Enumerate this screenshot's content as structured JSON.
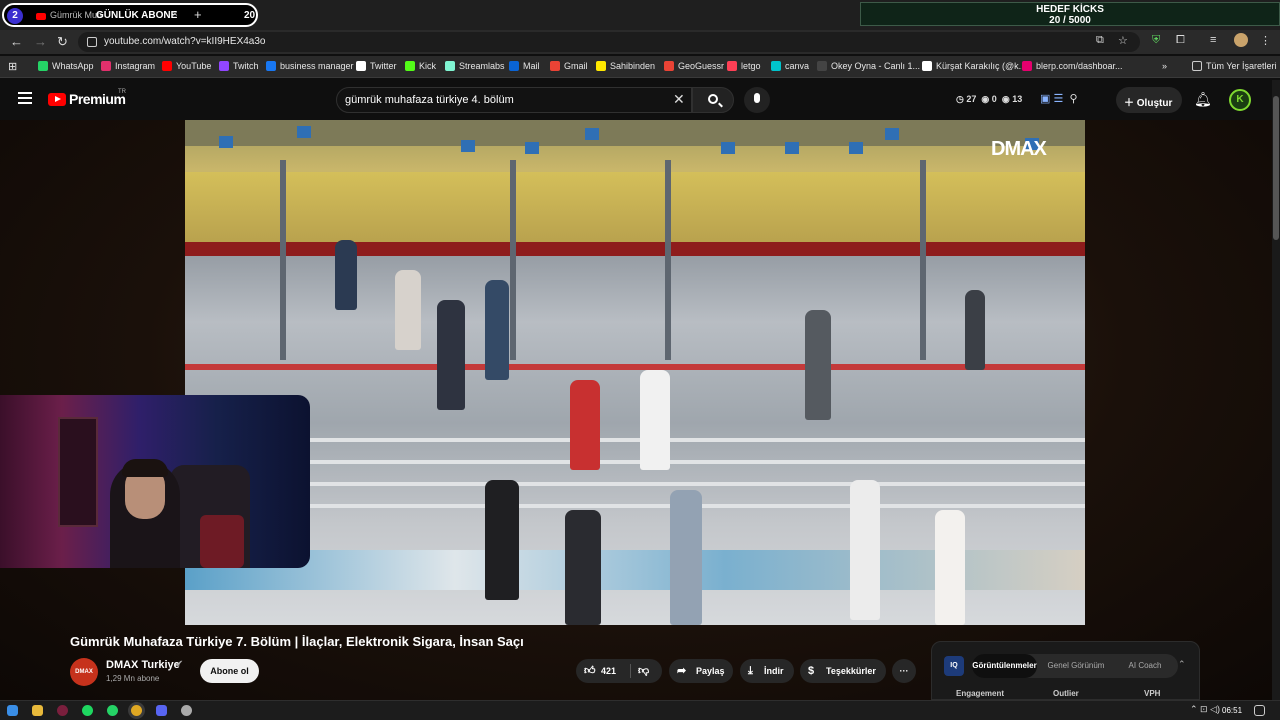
{
  "stream_overlay": {
    "badge_number": "2",
    "label": "GÜNLÜK ABONE",
    "count": "20",
    "tab_title": "Gümrük Muh",
    "tab_close": "×",
    "new_tab": "+"
  },
  "goal": {
    "title": "HEDEF KİCKS",
    "progress": "20 / 5000",
    "current": 20,
    "target": 5000
  },
  "address_bar": {
    "url": "youtube.com/watch?v=kII9HEX4a3o"
  },
  "bookmarks": {
    "items": [
      {
        "label": "WhatsApp",
        "color": "#25d366"
      },
      {
        "label": "Instagram",
        "color": "#e1306c"
      },
      {
        "label": "YouTube",
        "color": "#ff0000"
      },
      {
        "label": "Twitch",
        "color": "#9146ff"
      },
      {
        "label": "business manager",
        "color": "#1877f2"
      },
      {
        "label": "Twitter",
        "color": "#ffffff"
      },
      {
        "label": "Kick",
        "color": "#53fc18"
      },
      {
        "label": "Streamlabs",
        "color": "#80f5d2"
      },
      {
        "label": "Mail",
        "color": "#0a64d6"
      },
      {
        "label": "Gmail",
        "color": "#ea4335"
      },
      {
        "label": "Sahibinden",
        "color": "#ffe800"
      },
      {
        "label": "GeoGuessr",
        "color": "#ea4335"
      },
      {
        "label": "letgo",
        "color": "#ff3f55"
      },
      {
        "label": "canva",
        "color": "#00c4cc"
      },
      {
        "label": "Okey Oyna - Canlı 1...",
        "color": "#444444"
      },
      {
        "label": "Kürşat Karakılıç (@k...",
        "color": "#ffffff"
      },
      {
        "label": "blerp.com/dashboar...",
        "color": "#e6006e"
      }
    ],
    "more": "»",
    "all_bookmarks": "Tüm Yer İşaretleri"
  },
  "header": {
    "brand": "Premium",
    "country": "TR",
    "search_value": "gümrük muhafaza türkiye 4. bölüm",
    "ext_views": "27",
    "ext_a": "0",
    "ext_b": "13",
    "create_label": "Oluştur",
    "avatar_letter": "K"
  },
  "video": {
    "watermark": "DMAX",
    "title": "Gümrük Muhafaza Türkiye 7. Bölüm | İlaçlar, Elektronik Sigara, İnsan Saçı",
    "channel": "DMAX Turkiye",
    "channel_avatar": "DMAX",
    "subscribers": "1,29 Mn abone",
    "subscribe_label": "Abone ol",
    "likes": "421",
    "share_label": "Paylaş",
    "download_label": "İndir",
    "thanks_label": "Teşekkürler",
    "more": "···"
  },
  "iq_panel": {
    "logo": "IQ",
    "tabs": [
      "Görüntülenmeler",
      "Genel Görünüm",
      "AI Coach"
    ],
    "columns": [
      "Engagement",
      "Outlier",
      "VPH"
    ]
  },
  "taskbar": {
    "time": "06:51",
    "tray": "⌃ ⊡ ◁)"
  }
}
